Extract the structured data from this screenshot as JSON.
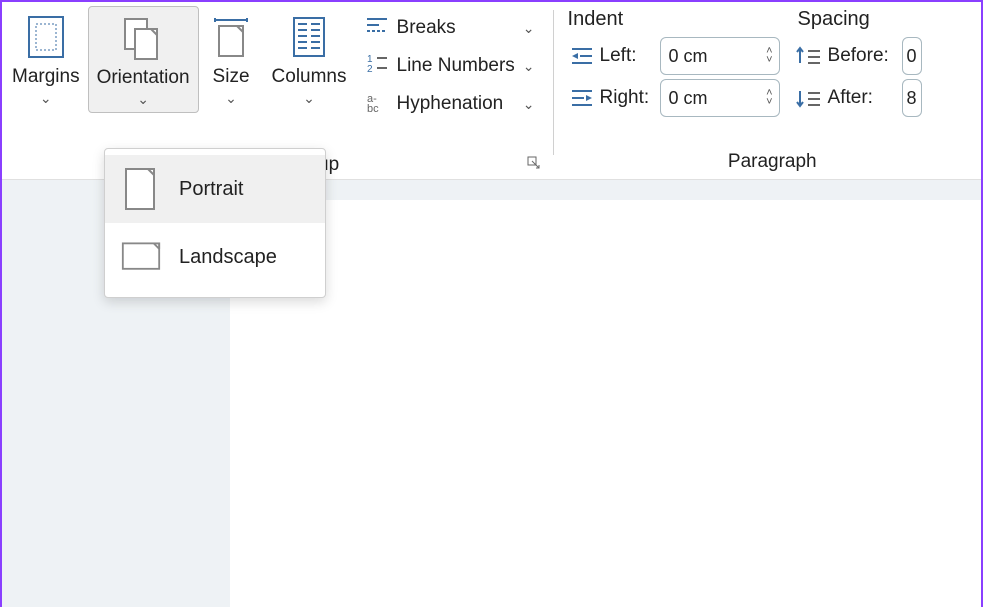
{
  "ribbon": {
    "pageSetup": {
      "margins": "Margins",
      "orientation": "Orientation",
      "size": "Size",
      "columns": "Columns",
      "breaks": "Breaks",
      "lineNumbers": "Line Numbers",
      "hyphenation": "Hyphenation",
      "groupLabelPartial": "up"
    },
    "paragraph": {
      "indentHeader": "Indent",
      "spacingHeader": "Spacing",
      "leftLabel": "Left:",
      "rightLabel": "Right:",
      "beforeLabel": "Before:",
      "afterLabel": "After:",
      "leftValue": "0 cm",
      "rightValue": "0 cm",
      "beforeValue": "0",
      "afterValue": "8",
      "groupLabel": "Paragraph"
    }
  },
  "dropdown": {
    "portrait": "Portrait",
    "landscape": "Landscape"
  }
}
